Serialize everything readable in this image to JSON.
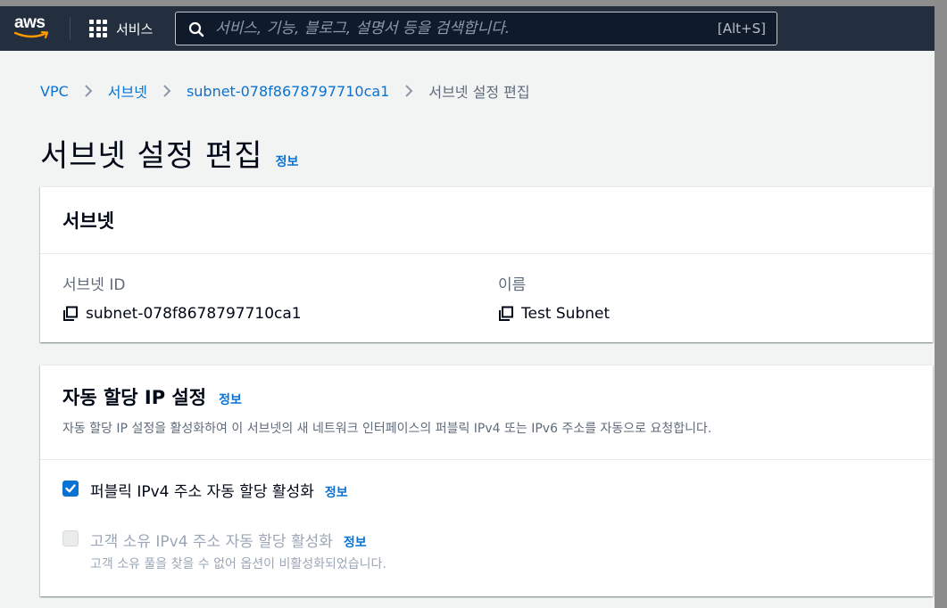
{
  "nav": {
    "logo_text": "aws",
    "services_label": "서비스",
    "search_placeholder": "서비스, 기능, 블로그, 설명서 등을 검색합니다.",
    "search_shortcut": "[Alt+S]"
  },
  "breadcrumb": {
    "items": [
      "VPC",
      "서브넷",
      "subnet-078f8678797710ca1"
    ],
    "current": "서브넷 설정 편집"
  },
  "page": {
    "title": "서브넷 설정 편집",
    "info_label": "정보"
  },
  "subnet_panel": {
    "title": "서브넷",
    "id_label": "서브넷 ID",
    "id_value": "subnet-078f8678797710ca1",
    "name_label": "이름",
    "name_value": "Test Subnet"
  },
  "auto_ip_panel": {
    "title": "자동 할당 IP 설정",
    "info_label": "정보",
    "description": "자동 할당 IP 설정을 활성화하여 이 서브넷의 새 네트워크 인터페이스의 퍼블릭 IPv4 또는 IPv6 주소를 자동으로 요청합니다.",
    "option_public_ipv4": {
      "label": "퍼블릭 IPv4 주소 자동 할당 활성화",
      "info_label": "정보",
      "checked": true
    },
    "option_customer_ipv4": {
      "label": "고객 소유 IPv4 주소 자동 할당 활성화",
      "info_label": "정보",
      "description": "고객 소유 풀을 찾을 수 없어 옵션이 비활성화되었습니다.",
      "checked": false,
      "disabled": true
    }
  },
  "colors": {
    "nav_bg": "#232f3e",
    "link": "#0972d3",
    "page_bg": "#f2f3f3"
  }
}
